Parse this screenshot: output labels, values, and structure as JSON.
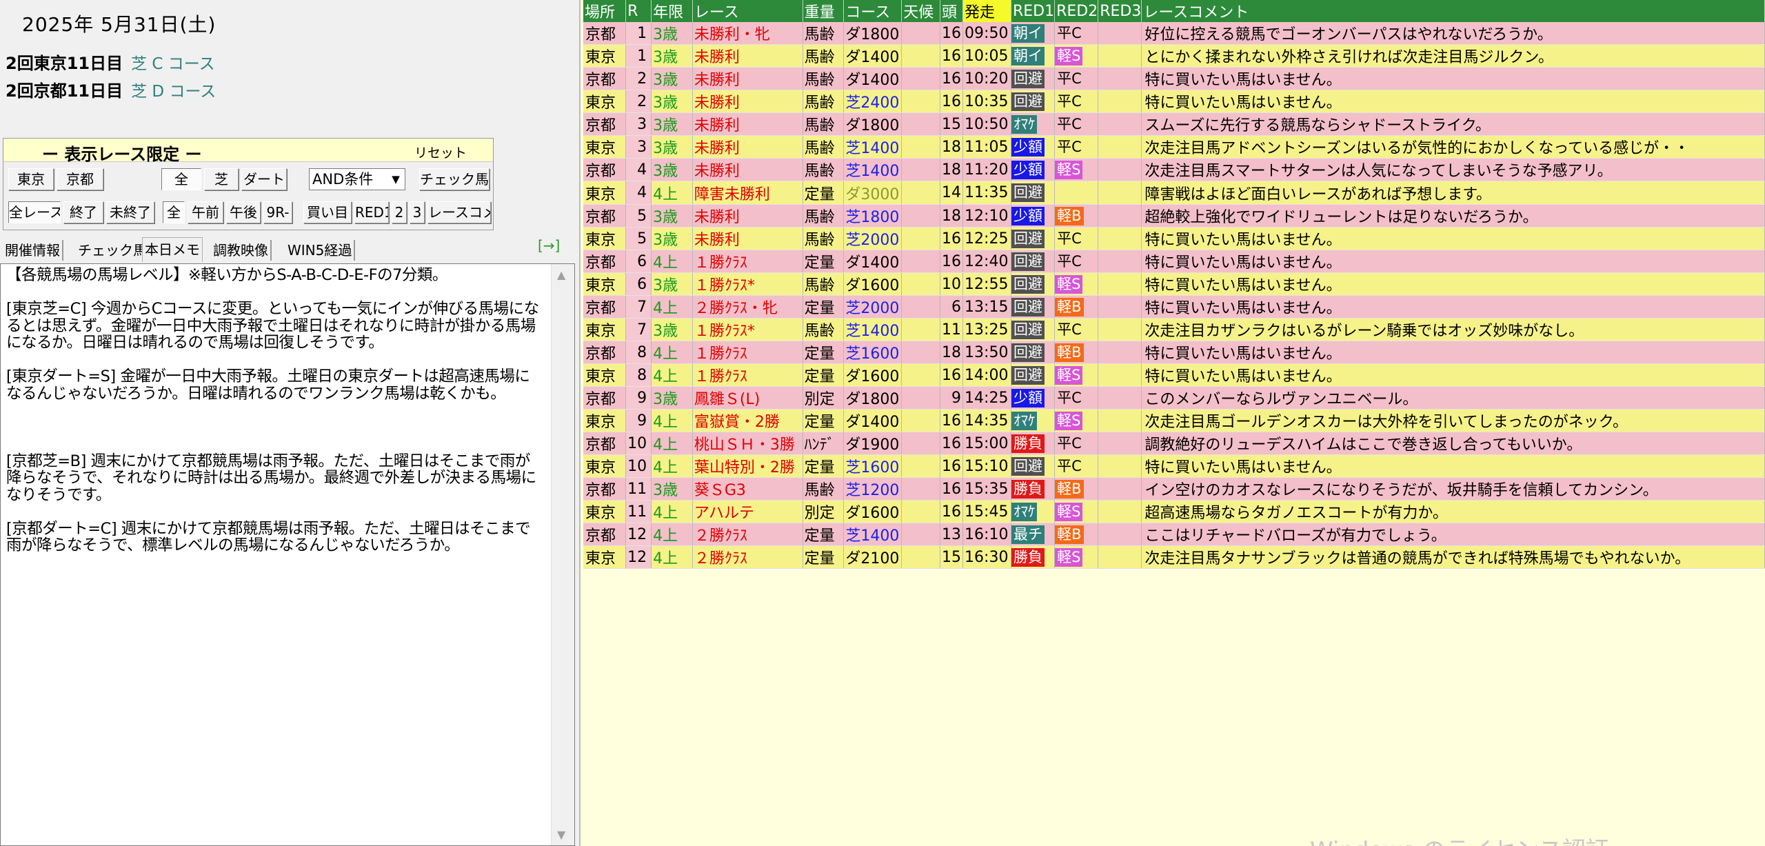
{
  "header": {
    "date": "2025年 5月31日(土)",
    "meetings": [
      {
        "name": "2回東京11日目",
        "course": "芝 C コース"
      },
      {
        "name": "2回京都11日目",
        "course": "芝 D コース"
      }
    ]
  },
  "filter": {
    "title": "ー 表示レース限定 ー",
    "reset": "リセット",
    "row1": {
      "places": [
        "東京",
        "京都"
      ],
      "surfaces": [
        "全",
        "芝",
        "ダート"
      ],
      "condition_selected": "AND条件",
      "check_horse": "チェック馬"
    },
    "row2": [
      "全レース",
      "終了",
      "未終了",
      "全",
      "午前",
      "午後",
      "9R-",
      "買い目",
      "RED1",
      "2",
      "3",
      "レースコメ"
    ]
  },
  "tabs": [
    "開催情報",
    "チェック馬",
    "本日メモ",
    "調教映像",
    "WIN5経過"
  ],
  "tab_arrow": "[→]",
  "memo": "【各競馬場の馬場レベル】※軽い方からS-A-B-C-D-E-Fの7分類。\n\n[東京芝=C] 今週からCコースに変更。といっても一気にインが伸びる馬場になるとは思えず。金曜が一日中大雨予報で土曜日はそれなりに時計が掛かる馬場になるか。日曜日は晴れるので馬場は回復しそうです。\n\n[東京ダート=S] 金曜が一日中大雨予報。土曜日の東京ダートは超高速馬場になるんじゃないだろうか。日曜は晴れるのでワンランク馬場は乾くかも。\n\n\n\n[京都芝=B] 週末にかけて京都競馬場は雨予報。ただ、土曜日はそこまで雨が降らなそうで、それなりに時計は出る馬場か。最終週で外差しが決まる馬場になりそうです。\n\n[京都ダート=C] 週末にかけて京都競馬場は雨予報。ただ、土曜日はそこまで雨が降らなそうで、標準レベルの馬場になるんじゃないだろうか。",
  "table": {
    "headers": [
      "場所",
      "R",
      "年限",
      "レース",
      "重量",
      "コース",
      "天候",
      "頭",
      "発走",
      "RED1",
      "RED2",
      "RED3",
      "レースコメント"
    ],
    "rows": [
      {
        "place": "京都",
        "r": "1",
        "age": "3歳",
        "race": "未勝利・牝",
        "weight": "馬齢",
        "course": "ダ1800",
        "surf": "dirt",
        "heads": "16",
        "time": "09:50",
        "r1": "朝イ",
        "r1c": "green",
        "r2": "平C",
        "r2c": "white",
        "comment": "好位に控える競馬でゴーオンバーパスはやれないだろうか。"
      },
      {
        "place": "東京",
        "r": "1",
        "age": "3歳",
        "race": "未勝利",
        "weight": "馬齢",
        "course": "ダ1400",
        "surf": "dirt",
        "heads": "16",
        "time": "10:05",
        "r1": "朝イ",
        "r1c": "green",
        "r2": "軽S",
        "r2c": "magenta",
        "comment": "とにかく揉まれない外枠さえ引ければ次走注目馬ジルクン。"
      },
      {
        "place": "京都",
        "r": "2",
        "age": "3歳",
        "race": "未勝利",
        "weight": "馬齢",
        "course": "ダ1400",
        "surf": "dirt",
        "heads": "16",
        "time": "10:20",
        "r1": "回避",
        "r1c": "gray",
        "r2": "平C",
        "r2c": "white",
        "comment": "特に買いたい馬はいません。"
      },
      {
        "place": "東京",
        "r": "2",
        "age": "3歳",
        "race": "未勝利",
        "weight": "馬齢",
        "course": "芝2400",
        "surf": "turf",
        "heads": "16",
        "time": "10:35",
        "r1": "回避",
        "r1c": "gray",
        "r2": "平C",
        "r2c": "white",
        "comment": "特に買いたい馬はいません。"
      },
      {
        "place": "京都",
        "r": "3",
        "age": "3歳",
        "race": "未勝利",
        "weight": "馬齢",
        "course": "ダ1800",
        "surf": "dirt",
        "heads": "15",
        "time": "10:50",
        "r1": "ｵﾏｹ",
        "r1c": "green",
        "r2": "平C",
        "r2c": "white",
        "comment": "スムーズに先行する競馬ならシャドーストライク。"
      },
      {
        "place": "東京",
        "r": "3",
        "age": "3歳",
        "race": "未勝利",
        "weight": "馬齢",
        "course": "芝1400",
        "surf": "turf",
        "heads": "18",
        "time": "11:05",
        "r1": "少額",
        "r1c": "blue",
        "r2": "平C",
        "r2c": "white",
        "comment": "次走注目馬アドベントシーズンはいるが気性的におかしくなっている感じが・・"
      },
      {
        "place": "京都",
        "r": "4",
        "age": "3歳",
        "race": "未勝利",
        "weight": "馬齢",
        "course": "芝1400",
        "surf": "turf",
        "heads": "18",
        "time": "11:20",
        "r1": "少額",
        "r1c": "blue",
        "r2": "軽S",
        "r2c": "magenta",
        "comment": "次走注目馬スマートサターンは人気になってしまいそうな予感アリ。"
      },
      {
        "place": "東京",
        "r": "4",
        "age": "4上",
        "race": "障害未勝利",
        "weight": "定量",
        "course": "ダ3000",
        "surf": "jump",
        "heads": "14",
        "time": "11:35",
        "r1": "回避",
        "r1c": "gray",
        "r2": "",
        "r2c": "white",
        "comment": "障害戦はよほど面白いレースがあれば予想します。"
      },
      {
        "place": "京都",
        "r": "5",
        "age": "3歳",
        "race": "未勝利",
        "weight": "馬齢",
        "course": "芝1800",
        "surf": "turf",
        "heads": "18",
        "time": "12:10",
        "r1": "少額",
        "r1c": "blue",
        "r2": "軽B",
        "r2c": "orange",
        "comment": "超絶較上強化でワイドリューレントは足りないだろうか。"
      },
      {
        "place": "東京",
        "r": "5",
        "age": "3歳",
        "race": "未勝利",
        "weight": "馬齢",
        "course": "芝2000",
        "surf": "turf",
        "heads": "16",
        "time": "12:25",
        "r1": "回避",
        "r1c": "gray",
        "r2": "平C",
        "r2c": "white",
        "comment": "特に買いたい馬はいません。"
      },
      {
        "place": "京都",
        "r": "6",
        "age": "4上",
        "race": "１勝ｸﾗｽ",
        "weight": "定量",
        "course": "ダ1400",
        "surf": "dirt",
        "heads": "16",
        "time": "12:40",
        "r1": "回避",
        "r1c": "gray",
        "r2": "平C",
        "r2c": "white",
        "comment": "特に買いたい馬はいません。"
      },
      {
        "place": "東京",
        "r": "6",
        "age": "3歳",
        "race": "１勝ｸﾗｽ*",
        "weight": "馬齢",
        "course": "ダ1600",
        "surf": "dirt",
        "heads": "10",
        "time": "12:55",
        "r1": "回避",
        "r1c": "gray",
        "r2": "軽S",
        "r2c": "magenta",
        "comment": "特に買いたい馬はいません。"
      },
      {
        "place": "京都",
        "r": "7",
        "age": "4上",
        "race": "２勝ｸﾗｽ・牝",
        "weight": "定量",
        "course": "芝2000",
        "surf": "turf",
        "heads": "6",
        "time": "13:15",
        "r1": "回避",
        "r1c": "gray",
        "r2": "軽B",
        "r2c": "orange",
        "comment": "特に買いたい馬はいません。"
      },
      {
        "place": "東京",
        "r": "7",
        "age": "3歳",
        "race": "１勝ｸﾗｽ*",
        "weight": "馬齢",
        "course": "芝1400",
        "surf": "turf",
        "heads": "11",
        "time": "13:25",
        "r1": "回避",
        "r1c": "gray",
        "r2": "平C",
        "r2c": "white",
        "comment": "次走注目カザンラクはいるがレーン騎乗ではオッズ妙味がなし。"
      },
      {
        "place": "京都",
        "r": "8",
        "age": "4上",
        "race": "１勝ｸﾗｽ",
        "weight": "定量",
        "course": "芝1600",
        "surf": "turf",
        "heads": "18",
        "time": "13:50",
        "r1": "回避",
        "r1c": "gray",
        "r2": "軽B",
        "r2c": "orange",
        "comment": "特に買いたい馬はいません。"
      },
      {
        "place": "東京",
        "r": "8",
        "age": "4上",
        "race": "１勝ｸﾗｽ",
        "weight": "定量",
        "course": "ダ1600",
        "surf": "dirt",
        "heads": "16",
        "time": "14:00",
        "r1": "回避",
        "r1c": "gray",
        "r2": "軽S",
        "r2c": "magenta",
        "comment": "特に買いたい馬はいません。"
      },
      {
        "place": "京都",
        "r": "9",
        "age": "3歳",
        "race": "鳳雛Ｓ(L)",
        "weight": "別定",
        "course": "ダ1800",
        "surf": "dirt",
        "heads": "9",
        "time": "14:25",
        "r1": "少額",
        "r1c": "blue",
        "r2": "平C",
        "r2c": "white",
        "comment": "このメンバーならルヴァンユニベール。"
      },
      {
        "place": "東京",
        "r": "9",
        "age": "4上",
        "race": "富嶽賞・2勝",
        "weight": "定量",
        "course": "ダ1400",
        "surf": "dirt",
        "heads": "16",
        "time": "14:35",
        "r1": "ｵﾏｹ",
        "r1c": "green",
        "r2": "軽S",
        "r2c": "magenta",
        "comment": "次走注目馬ゴールデンオスカーは大外枠を引いてしまったのがネック。"
      },
      {
        "place": "京都",
        "r": "10",
        "age": "4上",
        "race": "桃山ＳＨ・3勝",
        "weight": "ﾊﾝﾃﾞ",
        "course": "ダ1900",
        "surf": "dirt",
        "heads": "16",
        "time": "15:00",
        "r1": "勝負",
        "r1c": "red",
        "r2": "平C",
        "r2c": "white",
        "comment": "調教絶好のリューデスハイムはここで巻き返し合ってもいいか。"
      },
      {
        "place": "東京",
        "r": "10",
        "age": "4上",
        "race": "葉山特別・2勝",
        "weight": "定量",
        "course": "芝1600",
        "surf": "turf",
        "heads": "16",
        "time": "15:10",
        "r1": "回避",
        "r1c": "gray",
        "r2": "平C",
        "r2c": "white",
        "comment": "特に買いたい馬はいません。"
      },
      {
        "place": "京都",
        "r": "11",
        "age": "3歳",
        "race": "葵ＳG3",
        "weight": "馬齢",
        "course": "芝1200",
        "surf": "turf",
        "heads": "16",
        "time": "15:35",
        "r1": "勝負",
        "r1c": "red",
        "r2": "軽B",
        "r2c": "orange",
        "comment": "イン空けのカオスなレースになりそうだが、坂井騎手を信頼してカンシン。"
      },
      {
        "place": "東京",
        "r": "11",
        "age": "4上",
        "race": "アハルテ",
        "weight": "別定",
        "course": "ダ1600",
        "surf": "dirt",
        "heads": "16",
        "time": "15:45",
        "r1": "ｵﾏｹ",
        "r1c": "green",
        "r2": "軽S",
        "r2c": "magenta",
        "comment": "超高速馬場ならタガノエスコートが有力か。"
      },
      {
        "place": "京都",
        "r": "12",
        "age": "4上",
        "race": "２勝ｸﾗｽ",
        "weight": "定量",
        "course": "芝1400",
        "surf": "turf",
        "heads": "13",
        "time": "16:10",
        "r1": "最チ",
        "r1c": "green",
        "r2": "軽B",
        "r2c": "orange",
        "comment": "ここはリチャードバローズが有力でしょう。"
      },
      {
        "place": "東京",
        "r": "12",
        "age": "4上",
        "race": "２勝ｸﾗｽ",
        "weight": "定量",
        "course": "ダ2100",
        "surf": "dirt",
        "heads": "15",
        "time": "16:30",
        "r1": "勝負",
        "r1c": "red",
        "r2": "軽S",
        "r2c": "magenta",
        "comment": "次走注目馬タナサンブラックは普通の競馬ができれば特殊馬場でもやれないか。"
      }
    ]
  },
  "watermark": "Windows のライセンス認証"
}
